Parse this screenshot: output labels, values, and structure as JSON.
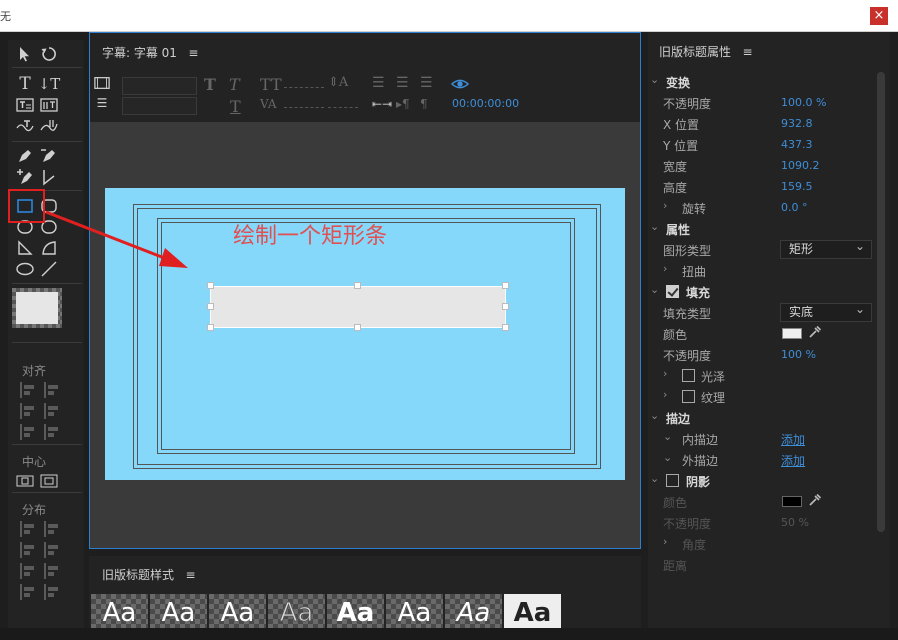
{
  "window": {
    "title_fragment": "无",
    "close_glyph": "×"
  },
  "tools": {
    "align_label": "对齐",
    "center_label": "中心",
    "distribute_label": "分布"
  },
  "center_panel": {
    "tab_title": "字幕: 字幕 01",
    "menu_glyph": "≡",
    "timecode": "00:00:00:00",
    "annotation": "绘制一个矩形条"
  },
  "styles_panel": {
    "tab_title": "旧版标题样式",
    "menu_glyph": "≡",
    "swatches": [
      "Aa",
      "Aa",
      "Aa",
      "Aa",
      "Aa",
      "Aa",
      "Aa",
      "Aa"
    ]
  },
  "properties": {
    "tab_title": "旧版标题属性",
    "menu_glyph": "≡",
    "transform": {
      "label": "变换",
      "opacity_label": "不透明度",
      "opacity": "100.0 %",
      "x_label": "X 位置",
      "x": "932.8",
      "y_label": "Y 位置",
      "y": "437.3",
      "width_label": "宽度",
      "width": "1090.2",
      "height_label": "高度",
      "height": "159.5",
      "rotation_label": "旋转",
      "rotation": "0.0 °"
    },
    "attributes": {
      "label": "属性",
      "graphic_type_label": "图形类型",
      "graphic_type": "矩形",
      "distort_label": "扭曲"
    },
    "fill": {
      "label": "填充",
      "fill_type_label": "填充类型",
      "fill_type": "实底",
      "color_label": "颜色",
      "color": "#f0f0f0",
      "opacity_label": "不透明度",
      "opacity": "100 %",
      "sheen_label": "光泽",
      "texture_label": "纹理"
    },
    "strokes": {
      "label": "描边",
      "inner_label": "内描边",
      "inner_action": "添加",
      "outer_label": "外描边",
      "outer_action": "添加"
    },
    "shadow": {
      "label": "阴影",
      "color_label": "颜色",
      "color": "#000000",
      "opacity_label": "不透明度",
      "opacity": "50 %",
      "angle_label": "角度",
      "distance_label": "距离"
    }
  },
  "colors": {
    "accent": "#3e8ed8",
    "canvas": "#86d8fb",
    "highlight": "#e02020"
  }
}
